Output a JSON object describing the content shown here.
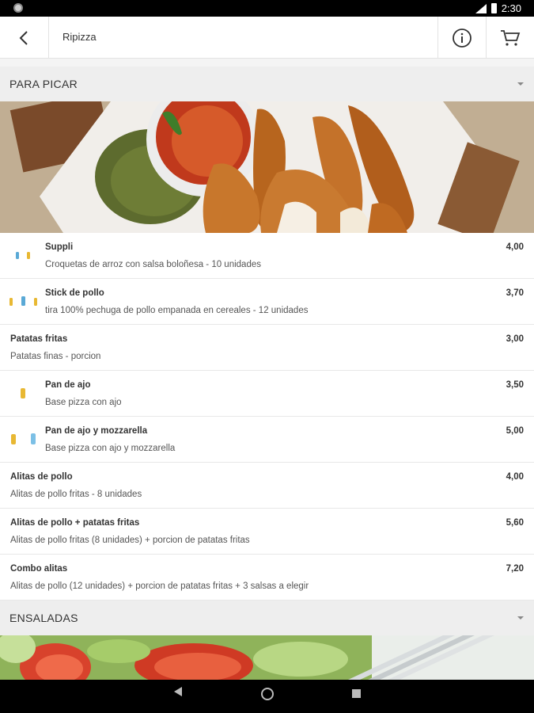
{
  "status": {
    "time": "2:30"
  },
  "header": {
    "title": "Ripizza",
    "back_icon": "arrow-left-icon",
    "info_icon": "info-circle-icon",
    "cart_icon": "cart-icon"
  },
  "sections": [
    {
      "title": "PARA PICAR",
      "items": [
        {
          "name": "Suppli",
          "description": "Croquetas de arroz con salsa boloñesa - 10 unidades",
          "price": "4,00",
          "badges": [
            "allergen-icon",
            "allergen-icon"
          ]
        },
        {
          "name": "Stick de pollo",
          "description": "tira 100% pechuga de pollo empanada en cereales - 12 unidades",
          "price": "3,70",
          "badges": [
            "allergen-icon",
            "allergen-icon",
            "allergen-icon"
          ]
        },
        {
          "name": "Patatas fritas",
          "description": "Patatas finas - porcion",
          "price": "3,00",
          "badges": []
        },
        {
          "name": "Pan de ajo",
          "description": "Base pizza con ajo",
          "price": "3,50",
          "badges": [
            "allergen-icon"
          ]
        },
        {
          "name": "Pan de ajo y mozzarella",
          "description": "Base pizza con ajo y mozzarella",
          "price": "5,00",
          "badges": [
            "allergen-icon",
            "allergen-icon"
          ]
        },
        {
          "name": "Alitas de pollo",
          "description": "Alitas de pollo fritas - 8 unidades",
          "price": "4,00",
          "badges": []
        },
        {
          "name": "Alitas de pollo + patatas fritas",
          "description": "Alitas de pollo fritas (8 unidades) + porcion de patatas fritas",
          "price": "5,60",
          "badges": []
        },
        {
          "name": "Combo alitas",
          "description": "Alitas de pollo (12 unidades) + porcion de patatas fritas + 3 salsas a elegir",
          "price": "7,20",
          "badges": []
        }
      ]
    },
    {
      "title": "ENSALADAS",
      "items": []
    }
  ]
}
